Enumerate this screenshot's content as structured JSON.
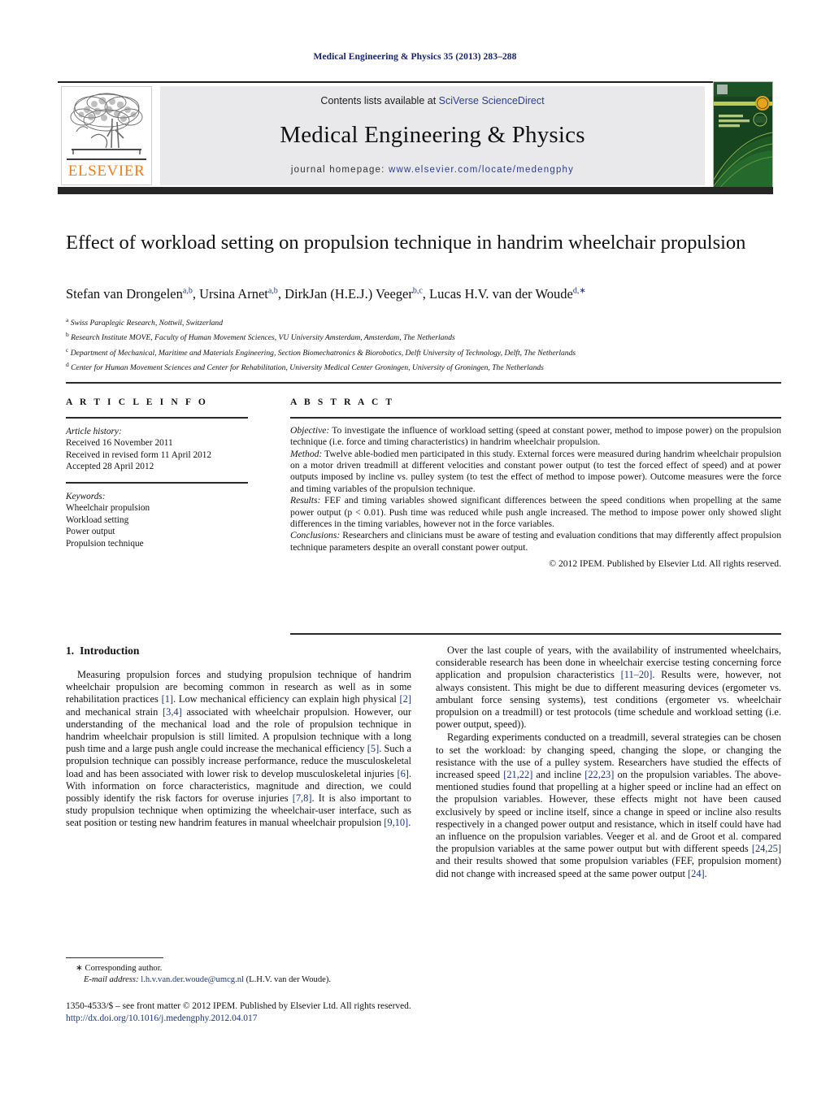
{
  "running_head": "Medical Engineering & Physics 35 (2013) 283–288",
  "masthead": {
    "contents_prefix": "Contents lists available at ",
    "contents_link": "SciVerse ScienceDirect",
    "journal_name": "Medical Engineering & Physics",
    "homepage_label": "journal homepage: ",
    "homepage_url": "www.elsevier.com/locate/medengphy",
    "publisher_wordmark": "ELSEVIER",
    "cover_title_lines": [
      "MEDICAL",
      "ENGINEERING",
      "& PHYSICS"
    ],
    "colors": {
      "link_blue": "#2b3f8c",
      "elsevier_orange": "#f07e18",
      "band_dark": "#262626",
      "panel_gray": "#e9e9ec",
      "cover_green": "#15441f",
      "cover_accent": "#b9cf4a",
      "cover_badge": "#e9a21c"
    }
  },
  "article": {
    "title": "Effect of workload setting on propulsion technique in handrim wheelchair propulsion",
    "authors_html": "Stefan van Drongelen<sup>a,b</sup>, Ursina Arnet<sup>a,b</sup>, DirkJan (H.E.J.) Veeger<sup>b,c</sup>, Lucas H.V. van der Woude<sup>d,∗</sup>",
    "affiliations": [
      {
        "mark": "a",
        "text": "Swiss Paraplegic Research, Nottwil, Switzerland"
      },
      {
        "mark": "b",
        "text": "Research Institute MOVE, Faculty of Human Movement Sciences, VU University Amsterdam, Amsterdam, The Netherlands"
      },
      {
        "mark": "c",
        "text": "Department of Mechanical, Maritime and Materials Engineering, Section Biomechatronics & Biorobotics, Delft University of Technology, Delft, The Netherlands"
      },
      {
        "mark": "d",
        "text": "Center for Human Movement Sciences and Center for Rehabilitation, University Medical Center Groningen, University of Groningen, The Netherlands"
      }
    ]
  },
  "article_info": {
    "heading": "A R T I C L E    I N F O",
    "history_label": "Article history:",
    "history": [
      "Received 16 November 2011",
      "Received in revised form 11 April 2012",
      "Accepted 28 April 2012"
    ],
    "keywords_label": "Keywords:",
    "keywords": [
      "Wheelchair propulsion",
      "Workload setting",
      "Power output",
      "Propulsion technique"
    ]
  },
  "abstract": {
    "heading": "A B S T R A C T",
    "sections": [
      {
        "label": "Objective:",
        "text": " To investigate the influence of workload setting (speed at constant power, method to impose power) on the propulsion technique (i.e. force and timing characteristics) in handrim wheelchair propulsion."
      },
      {
        "label": "Method:",
        "text": " Twelve able-bodied men participated in this study. External forces were measured during handrim wheelchair propulsion on a motor driven treadmill at different velocities and constant power output (to test the forced effect of speed) and at power outputs imposed by incline vs. pulley system (to test the effect of method to impose power). Outcome measures were the force and timing variables of the propulsion technique."
      },
      {
        "label": "Results:",
        "text": " FEF and timing variables showed significant differences between the speed conditions when propelling at the same power output (p < 0.01). Push time was reduced while push angle increased. The method to impose power only showed slight differences in the timing variables, however not in the force variables."
      },
      {
        "label": "Conclusions:",
        "text": " Researchers and clinicians must be aware of testing and evaluation conditions that may differently affect propulsion technique parameters despite an overall constant power output."
      }
    ],
    "copyright": "© 2012 IPEM. Published by Elsevier Ltd. All rights reserved."
  },
  "body": {
    "section_number": "1.",
    "section_title": "Introduction",
    "left_paragraphs": [
      "Measuring propulsion forces and studying propulsion technique of handrim wheelchair propulsion are becoming common in research as well as in some rehabilitation practices [1]. Low mechanical efficiency can explain high physical [2] and mechanical strain [3,4] associated with wheelchair propulsion. However, our understanding of the mechanical load and the role of propulsion technique in handrim wheelchair propulsion is still limited. A propulsion technique with a long push time and a large push angle could increase the mechanical efficiency [5]. Such a propulsion technique can possibly increase performance, reduce the musculoskeletal load and has been associated with lower risk to develop musculoskeletal injuries [6]. With information on force characteristics, magnitude and direction, we could possibly identify the risk factors for overuse injuries [7,8]. It is also important to study propulsion technique when optimizing the wheelchair-user interface, such as seat position or testing new handrim features in manual wheelchair propulsion [9,10]."
    ],
    "right_paragraphs": [
      "Over the last couple of years, with the availability of instrumented wheelchairs, considerable research has been done in wheelchair exercise testing concerning force application and propulsion characteristics [11–20]. Results were, however, not always consistent. This might be due to different measuring devices (ergometer vs. ambulant force sensing systems), test conditions (ergometer vs. wheelchair propulsion on a treadmill) or test protocols (time schedule and workload setting (i.e. power output, speed)).",
      "Regarding experiments conducted on a treadmill, several strategies can be chosen to set the workload: by changing speed, changing the slope, or changing the resistance with the use of a pulley system. Researchers have studied the effects of increased speed [21,22] and incline [22,23] on the propulsion variables. The above-mentioned studies found that propelling at a higher speed or incline had an effect on the propulsion variables. However, these effects might not have been caused exclusively by speed or incline itself, since a change in speed or incline also results respectively in a changed power output and resistance, which in itself could have had an influence on the propulsion variables. Veeger et al. and de Groot et al. compared the propulsion variables at the same power output but with different speeds [24,25] and their results showed that some propulsion variables (FEF, propulsion moment) did not change with increased speed at the same power output [24]."
    ]
  },
  "footer": {
    "corresponding_marker": "∗",
    "corresponding_label": " Corresponding author.",
    "email_label": "E-mail address:",
    "email": "l.h.v.van.der.woude@umcg.nl",
    "email_owner": "(L.H.V. van der Woude).",
    "imprint": "1350-4533/$ – see front matter © 2012 IPEM. Published by Elsevier Ltd. All rights reserved.",
    "doi": "http://dx.doi.org/10.1016/j.medengphy.2012.04.017"
  }
}
